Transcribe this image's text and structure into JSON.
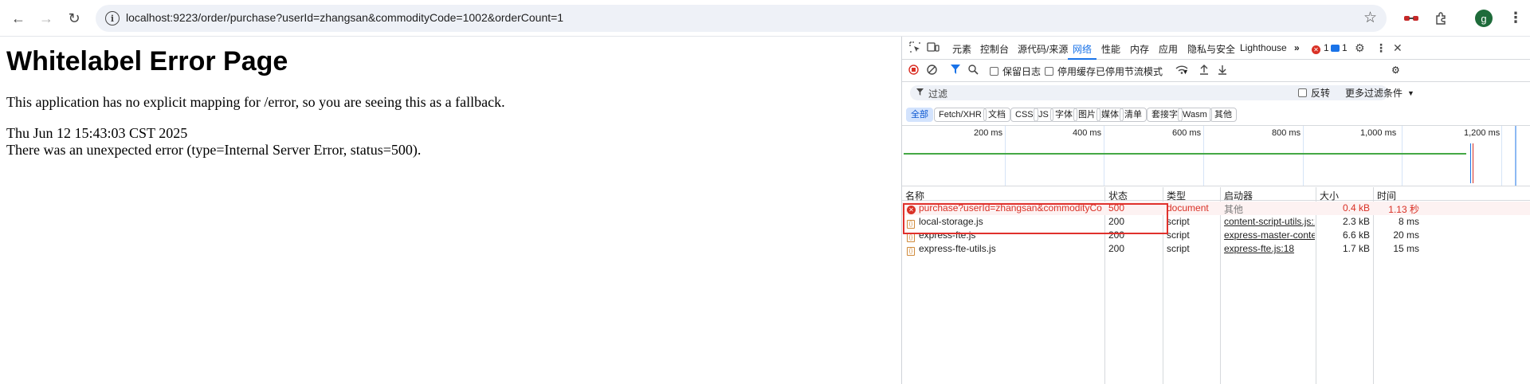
{
  "browser": {
    "url": "localhost:9223/order/purchase?userId=zhangsan&commodityCode=1002&orderCount=1",
    "avatar_letter": "g"
  },
  "page": {
    "title": "Whitelabel Error Page",
    "message": "This application has no explicit mapping for /error, so you are seeing this as a fallback.",
    "timestamp": "Thu Jun 12 15:43:03 CST 2025",
    "error": "There was an unexpected error (type=Internal Server Error, status=500)."
  },
  "devtools": {
    "tabs": [
      "元素",
      "控制台",
      "源代码/来源",
      "网络",
      "性能",
      "内存",
      "应用",
      "隐私与安全",
      "Lighthouse"
    ],
    "active_tab": "网络",
    "error_count": "1",
    "message_count": "1",
    "toolbar": {
      "preserve_log": "保留日志",
      "disable_cache": "停用缓存",
      "throttle": "已停用节流模式"
    },
    "filter": {
      "placeholder": "过滤",
      "invert": "反转",
      "more_filters": "更多过滤条件"
    },
    "type_filters": [
      "全部",
      "Fetch/XHR",
      "文档",
      "CSS",
      "JS",
      "字体",
      "图片",
      "媒体",
      "清单",
      "套接字",
      "Wasm",
      "其他"
    ],
    "timeline_labels": [
      "200 ms",
      "400 ms",
      "600 ms",
      "800 ms",
      "1,000 ms",
      "1,200 ms"
    ],
    "columns": [
      "名称",
      "状态",
      "类型",
      "启动器",
      "大小",
      "时间"
    ],
    "rows": [
      {
        "name": "purchase?userId=zhangsan&commodityCode=...",
        "status": "500",
        "type": "document",
        "initiator": "其他",
        "size": "0.4 kB",
        "time": "1.13 秒",
        "error": true
      },
      {
        "name": "local-storage.js",
        "status": "200",
        "type": "script",
        "initiator": "content-script-utils.js:18",
        "size": "2.3 kB",
        "time": "8 ms",
        "error": false
      },
      {
        "name": "express-fte.js",
        "status": "200",
        "type": "script",
        "initiator": "express-master-content-",
        "size": "6.6 kB",
        "time": "20 ms",
        "error": false
      },
      {
        "name": "express-fte-utils.js",
        "status": "200",
        "type": "script",
        "initiator": "express-fte.js:18",
        "size": "1.7 kB",
        "time": "15 ms",
        "error": false
      }
    ]
  }
}
